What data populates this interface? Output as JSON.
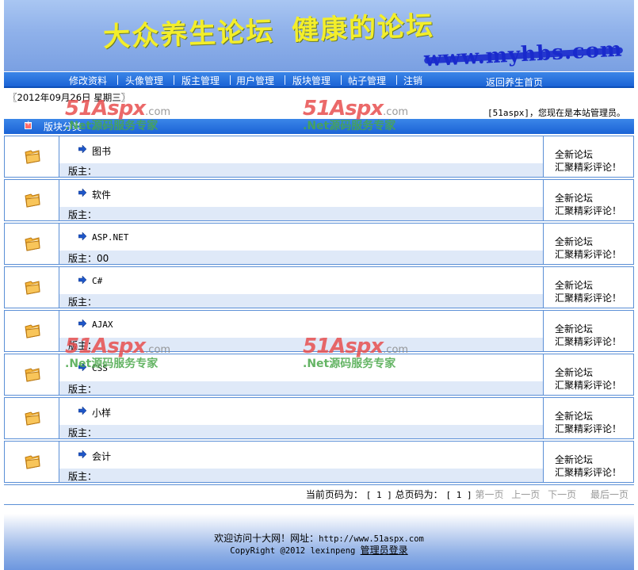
{
  "banner": {
    "title_part1": "大众养生论坛",
    "title_part2": "健康的论坛",
    "url": "www.myhbs.com"
  },
  "nav": {
    "items": [
      {
        "label": "修改资料"
      },
      {
        "label": "头像管理"
      },
      {
        "label": "版主管理"
      },
      {
        "label": "用户管理"
      },
      {
        "label": "版块管理"
      },
      {
        "label": "帖子管理"
      },
      {
        "label": "注销"
      }
    ],
    "home_label": "返回养生首页"
  },
  "date_text": "〖2012年09月26日 星期三〗",
  "welcome_text": "[51aspx]，您现在是本站管理员。",
  "category_title": "版块分类",
  "forums": [
    {
      "name": "图书",
      "moderator": "版主：",
      "line1": "全新论坛",
      "line2": "汇聚精彩评论！"
    },
    {
      "name": "软件",
      "moderator": "版主：",
      "line1": "全新论坛",
      "line2": "汇聚精彩评论！"
    },
    {
      "name": "ASP.NET",
      "moderator": "版主：00",
      "line1": "全新论坛",
      "line2": "汇聚精彩评论！"
    },
    {
      "name": "C#",
      "moderator": "版主：",
      "line1": "全新论坛",
      "line2": "汇聚精彩评论！"
    },
    {
      "name": "AJAX",
      "moderator": "版主：",
      "line1": "全新论坛",
      "line2": "汇聚精彩评论！"
    },
    {
      "name": "CSS",
      "moderator": "版主：",
      "line1": "全新论坛",
      "line2": "汇聚精彩评论！"
    },
    {
      "name": "小样",
      "moderator": "版主：",
      "line1": "全新论坛",
      "line2": "汇聚精彩评论！"
    },
    {
      "name": "会计",
      "moderator": "版主：",
      "line1": "全新论坛",
      "line2": "汇聚精彩评论！"
    }
  ],
  "pager": {
    "current_label": "当前页码为：",
    "current_value": "[ 1 ]",
    "total_label": "总页码为：",
    "total_value": "[ 1 ]",
    "first": "第一页",
    "prev": "上一页",
    "next": "下一页",
    "last": "最后一页"
  },
  "footer": {
    "visit_text": "欢迎访问十大网！网址：",
    "site_url": "http://www.51aspx.com",
    "copyright": "CopyRight @2012 lexinpeng",
    "admin_login": "管理员登录"
  },
  "watermark": {
    "logo": "51Aspx",
    "logo_suffix": ".com",
    "tagline": ".Net源码服务专家"
  },
  "colors": {
    "nav_blue": "#1b63d6",
    "row_border": "#5b8fd6",
    "mod_strip": "#dfe9f8",
    "banner_title": "#f3ee2a",
    "disabled_link": "#999999"
  },
  "icons": {
    "forum_icon": "folder-icon",
    "forum_link_icon": "arrow-right-icon",
    "category_bullet": "plus-bullet-icon"
  }
}
